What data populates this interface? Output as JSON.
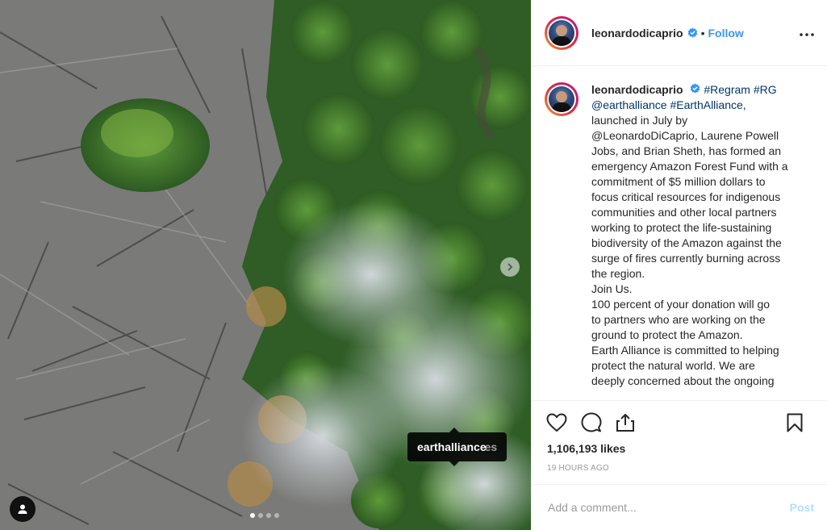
{
  "post": {
    "image_alt": "",
    "tag_tooltip": "earthalliance",
    "tag_tooltip_overlap": "es",
    "carousel_dots": 4,
    "carousel_active": 0
  },
  "header": {
    "username": "leonardodicaprio",
    "separator": "•",
    "follow_label": "Follow"
  },
  "caption": {
    "username": "leonardodicaprio",
    "lines": [
      "#Regram #RG",
      "@earthalliance #EarthAlliance,",
      "launched in July by",
      "@LeonardoDiCaprio, Laurene Powell",
      "Jobs, and Brian Sheth, has formed an",
      "emergency Amazon Forest Fund with a",
      "commitment of $5 million dollars to",
      "focus critical resources for indigenous",
      "communities and other local partners",
      "working to protect the life-sustaining",
      "biodiversity of the Amazon against the",
      "surge of fires currently burning across",
      "the region.",
      "Join Us.",
      "100 percent of your donation will go",
      "to partners who are working on the",
      "ground to protect the Amazon.",
      "Earth Alliance is committed to helping",
      "protect the natural world. We are",
      "deeply concerned about the ongoing"
    ]
  },
  "stats": {
    "likes": "1,106,193 likes",
    "time": "19 HOURS AGO"
  },
  "comment_box": {
    "placeholder": "Add a comment...",
    "post_label": "Post"
  },
  "colors": {
    "link_blue": "#3897f0",
    "verified_blue": "#3897f0",
    "post_disabled": "#b2dffc"
  }
}
